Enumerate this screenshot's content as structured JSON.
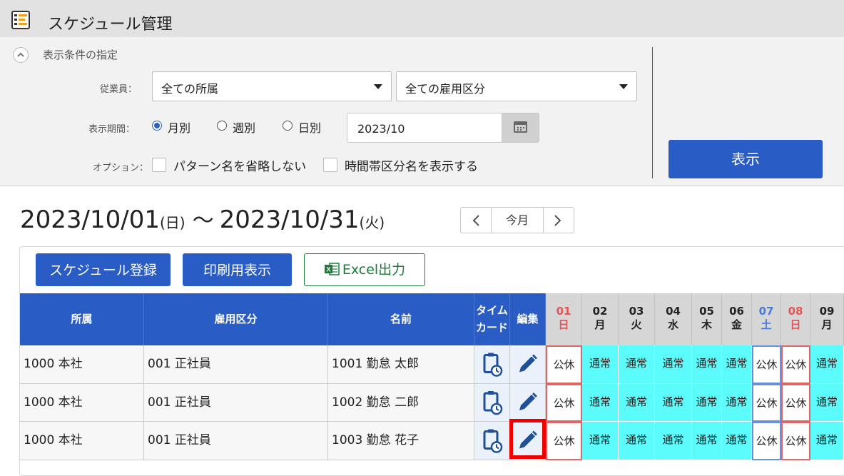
{
  "app": {
    "title": "スケジュール管理",
    "icon": "schedule-app-icon"
  },
  "conditions": {
    "title": "表示条件の指定",
    "employee_label": "従業員：",
    "department_select": "全ての所属",
    "employment_select": "全ての雇用区分",
    "period_label": "表示期間：",
    "period_options": [
      "月別",
      "週別",
      "日別"
    ],
    "period_selected": "月別",
    "date_value": "2023/10",
    "option_label": "オプション：",
    "option_checks": [
      "パターン名を省略しない",
      "時間帯区分名を表示する"
    ],
    "show_button": "表示"
  },
  "range": {
    "start": "2023/10/01",
    "start_dow": "(日)",
    "tilde": "〜",
    "end": "2023/10/31",
    "end_dow": "(火)",
    "today_button": "今月"
  },
  "actions": {
    "register": "スケジュール登録",
    "print": "印刷用表示",
    "excel": "Excel出力"
  },
  "table": {
    "headers": {
      "dept": "所属",
      "type": "雇用区分",
      "name": "名前",
      "timecard_1": "タイム",
      "timecard_2": "カード",
      "edit": "編集"
    },
    "days": [
      {
        "num": "01",
        "dow": "日",
        "color": "#e05555"
      },
      {
        "num": "02",
        "dow": "月",
        "color": "#222222"
      },
      {
        "num": "03",
        "dow": "火",
        "color": "#222222"
      },
      {
        "num": "04",
        "dow": "水",
        "color": "#222222"
      },
      {
        "num": "05",
        "dow": "木",
        "color": "#222222"
      },
      {
        "num": "06",
        "dow": "金",
        "color": "#222222"
      },
      {
        "num": "07",
        "dow": "土",
        "color": "#4a7ad8"
      },
      {
        "num": "08",
        "dow": "日",
        "color": "#e05555"
      },
      {
        "num": "09",
        "dow": "月",
        "color": "#222222"
      }
    ],
    "rows": [
      {
        "dept": "1000 本社",
        "type": "001 正社員",
        "name": "1001 勤怠 太郎",
        "shifts": [
          "公休",
          "通常",
          "通常",
          "通常",
          "通常",
          "通常",
          "公休",
          "公休",
          "通常"
        ]
      },
      {
        "dept": "1000 本社",
        "type": "001 正社員",
        "name": "1002 勤怠 二郎",
        "shifts": [
          "公休",
          "通常",
          "通常",
          "通常",
          "通常",
          "通常",
          "公休",
          "公休",
          "通常"
        ]
      },
      {
        "dept": "1000 本社",
        "type": "001 正社員",
        "name": "1003 勤怠 花子",
        "shifts": [
          "公休",
          "通常",
          "通常",
          "通常",
          "通常",
          "通常",
          "公休",
          "公休",
          "通常"
        ]
      }
    ]
  },
  "colors": {
    "primary": "#2a5cc5",
    "workday": "#5cfcfc",
    "sunday": "#e05555",
    "saturday": "#4a7ad8",
    "highlight": "#ee0000"
  }
}
